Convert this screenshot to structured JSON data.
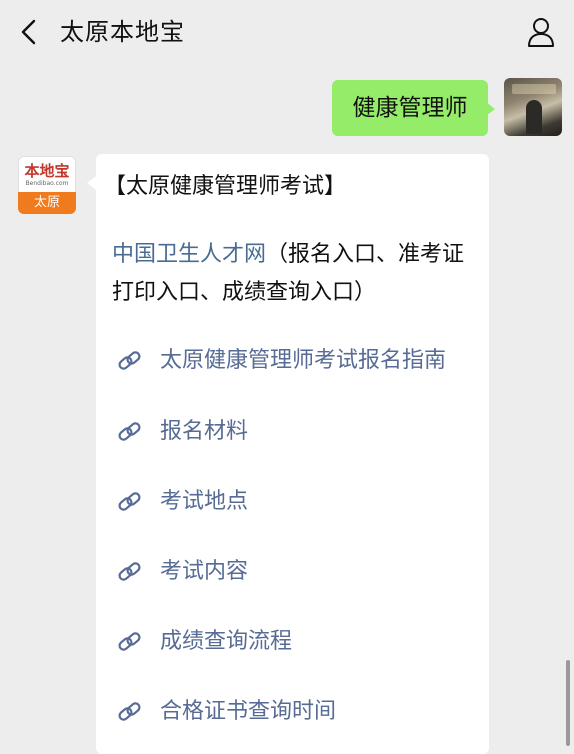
{
  "header": {
    "title": "太原本地宝"
  },
  "outgoing_message": {
    "text": "健康管理师"
  },
  "bot": {
    "logo_text": "本地宝",
    "logo_sub": "Bendibao.com",
    "logo_city": "太原"
  },
  "incoming_message": {
    "heading": "【太原健康管理师考试】",
    "intro_link": "中国卫生人才网",
    "intro_rest": "（报名入口、准考证打印入口、成绩查询入口）",
    "links": [
      {
        "label": "太原健康管理师考试报名指南"
      },
      {
        "label": "报名材料"
      },
      {
        "label": "考试地点"
      },
      {
        "label": "考试内容"
      },
      {
        "label": "成绩查询流程"
      },
      {
        "label": "合格证书查询时间"
      }
    ]
  },
  "colors": {
    "background": "#ededed",
    "outgoing_bubble": "#95ec69",
    "incoming_bubble": "#ffffff",
    "link": "#576b95",
    "logo_accent": "#f07b1e"
  },
  "icons": {
    "back": "chevron-left-icon",
    "profile": "person-icon",
    "link": "link-icon"
  }
}
